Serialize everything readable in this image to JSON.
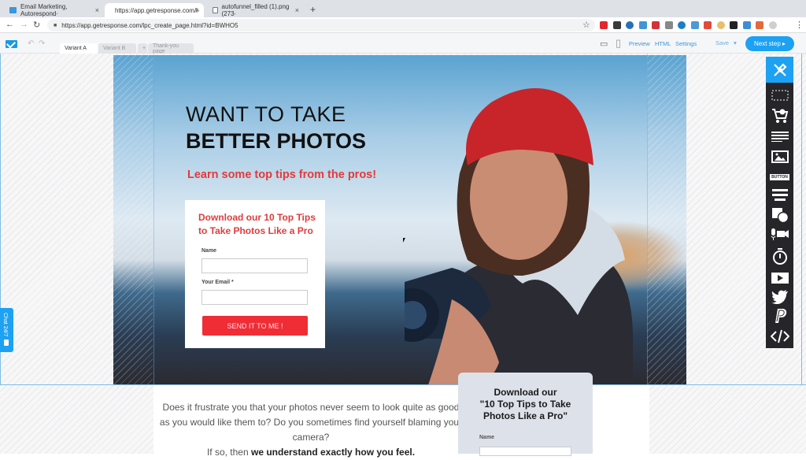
{
  "browser": {
    "tabs": [
      {
        "title": "Email Marketing, Autorespond·",
        "active": false
      },
      {
        "title": "https://app.getresponse.com/l·",
        "active": true
      },
      {
        "title": "autofunnel_filled (1).png (273·",
        "active": false
      }
    ],
    "close_glyph": "×",
    "new_tab_glyph": "+",
    "url": "https://app.getresponse.com/lpc_create_page.html?id=BWHO5",
    "nav": {
      "back": "←",
      "forward": "→",
      "reload": "↻",
      "lock": "🔒",
      "star": "☆",
      "menu": "⋮"
    },
    "extensions": [
      {
        "name": "a-ext",
        "color": "#e4262d"
      },
      {
        "name": "m-ext",
        "color": "#3a3a3a"
      },
      {
        "name": "clock-ext",
        "color": "#2b6fb8"
      },
      {
        "name": "cloud-ext",
        "color": "#3f95d6"
      },
      {
        "name": "badge-ext",
        "color": "#d6323a"
      },
      {
        "name": "printer-ext",
        "color": "#888888"
      },
      {
        "name": "g-ext",
        "color": "#1a7fc4"
      },
      {
        "name": "tag-ext",
        "color": "#4b9bd6"
      },
      {
        "name": "dots-ext",
        "color": "#e24a3b"
      },
      {
        "name": "circle-ext",
        "color": "#e6c06a"
      },
      {
        "name": "check-ext",
        "color": "#222222"
      },
      {
        "name": "iq-ext",
        "color": "#3c8fd6"
      },
      {
        "name": "heart-ext",
        "color": "#e26b3a"
      },
      {
        "name": "profile-ext",
        "color": "#cfcfcf"
      }
    ]
  },
  "app_bar": {
    "undo": "↶",
    "redo": "↷",
    "variant_tabs": [
      {
        "label": "Variant A",
        "active": true
      },
      {
        "label": "Variant B",
        "active": false
      },
      {
        "label": "+",
        "active": false
      },
      {
        "label": "Thank-you page",
        "active": false
      }
    ],
    "desktop_icon": "▭",
    "mobile_icon": "▯",
    "preview": "Preview",
    "html": "HTML",
    "settings": "Settings",
    "save": "Save",
    "save_caret": "▾",
    "next_step": "Next step ▸"
  },
  "hero": {
    "headline_line1": "WANT TO TAKE",
    "headline_line2": "BETTER PHOTOS",
    "subheadline": "Learn some top tips from the pros!",
    "form": {
      "title": "Download our 10 Top Tips to Take Photos Like a Pro",
      "name_label": "Name",
      "name_value": "",
      "email_label": "Your Email *",
      "email_value": "",
      "submit_label": "SEND IT TO ME !"
    }
  },
  "body": {
    "paragraph": "Does it frustrate you that your photos never seem to look quite as good as you would like them to? Do you sometimes find yourself blaming your camera?",
    "line4_prefix": "If so, then ",
    "line4_bold": "we understand exactly how you feel."
  },
  "secondary_form": {
    "title_line1": "Download our",
    "title_line2": "\"10 Top Tips to Take",
    "title_line3": "Photos Like a Pro\"",
    "name_label": "Name",
    "name_value": ""
  },
  "toolbar": {
    "items": [
      {
        "name": "tools",
        "tooltip": ""
      },
      {
        "name": "section"
      },
      {
        "name": "shop"
      },
      {
        "name": "text"
      },
      {
        "name": "image"
      },
      {
        "name": "button",
        "label": "BUTTON"
      },
      {
        "name": "form"
      },
      {
        "name": "shapes"
      },
      {
        "name": "webinar"
      },
      {
        "name": "timer"
      },
      {
        "name": "video"
      },
      {
        "name": "twitter"
      },
      {
        "name": "paypal"
      },
      {
        "name": "code"
      }
    ]
  },
  "chat": {
    "label": "Chat 24/7"
  },
  "colors": {
    "accent": "#1da1f2",
    "cta_red": "#f02d35",
    "headline_red": "#e33a3a",
    "toolbar_bg": "#26262a"
  }
}
